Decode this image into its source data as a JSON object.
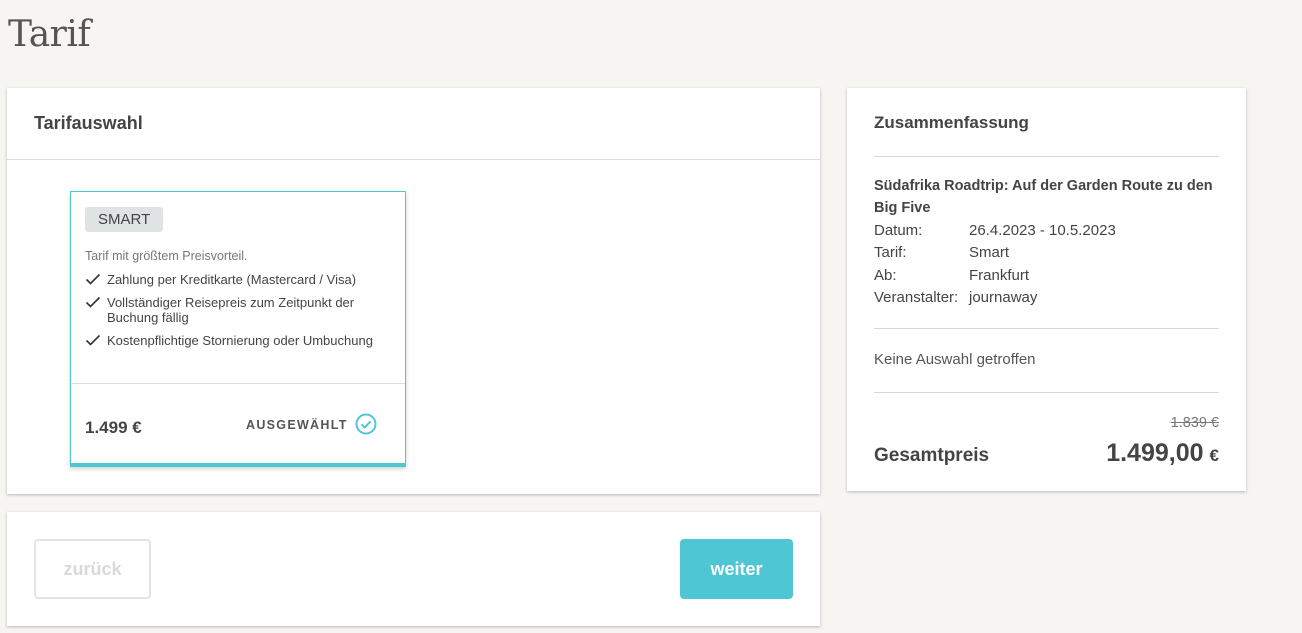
{
  "page": {
    "title": "Tarif"
  },
  "tarif_panel": {
    "heading": "Tarifauswahl",
    "tariff": {
      "badge": "SMART",
      "description": "Tarif mit größtem Preisvorteil.",
      "features": [
        "Zahlung per Kreditkarte (Mastercard / Visa)",
        "Vollständiger Reisepreis zum Zeitpunkt der Buchung fällig",
        "Kostenpflichtige Stornierung oder Umbuchung"
      ],
      "price": "1.499 €",
      "status_label": "AUSGEWÄHLT",
      "status_icon": "check-circle-icon"
    }
  },
  "nav": {
    "back_label": "zurück",
    "next_label": "weiter"
  },
  "summary": {
    "heading": "Zusammenfassung",
    "trip_title": "Südafrika Roadtrip: Auf der Garden Route zu den Big Five",
    "details": [
      {
        "key": "Datum:",
        "value": "26.4.2023 - 10.5.2023"
      },
      {
        "key": "Tarif:",
        "value": "Smart"
      },
      {
        "key": "Ab:",
        "value": "Frankfurt"
      },
      {
        "key": "Veranstalter:",
        "value": "journaway"
      }
    ],
    "no_selection": "Keine Auswahl getroffen",
    "old_price": "1.839 €",
    "total_label": "Gesamtpreis",
    "total_amount": "1.499,00",
    "total_currency": "€"
  },
  "colors": {
    "accent": "#4fc6d4",
    "background": "#f6f5f1",
    "badge_bg": "#dfe3e4"
  }
}
